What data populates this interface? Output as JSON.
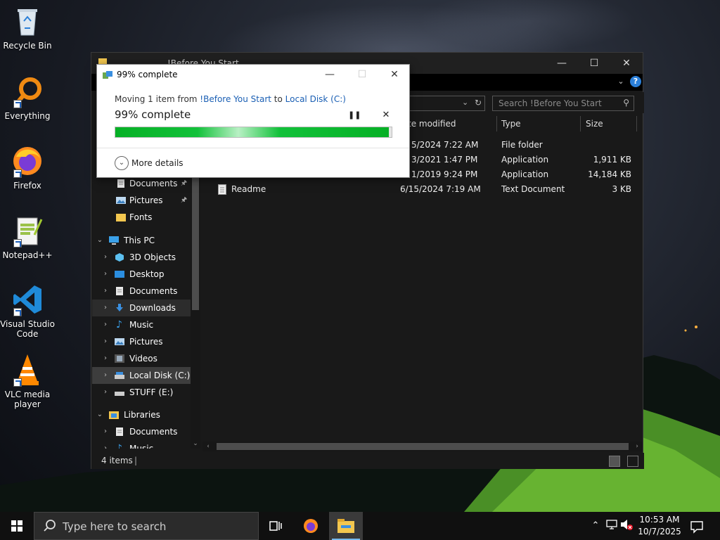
{
  "desktop": {
    "icons": [
      {
        "label": "Recycle Bin",
        "icon": "recycle-bin-icon"
      },
      {
        "label": "Everything",
        "icon": "everything-search-icon"
      },
      {
        "label": "Firefox",
        "icon": "firefox-icon"
      },
      {
        "label": "Notepad++",
        "icon": "notepad-plus-plus-icon"
      },
      {
        "label": "Visual Studio Code",
        "icon": "vscode-icon"
      },
      {
        "label": "VLC media player",
        "icon": "vlc-icon"
      }
    ]
  },
  "explorer": {
    "title": "!Before You Start",
    "search_placeholder": "Search !Before You Start",
    "columns": {
      "date": "Date modified",
      "type": "Type",
      "size": "Size"
    },
    "files": [
      {
        "name": "",
        "date": "6/15/2024 7:22 AM",
        "type": "File folder",
        "size": ""
      },
      {
        "name": "",
        "date": "6/3/2021 1:47 PM",
        "type": "Application",
        "size": "1,911 KB"
      },
      {
        "name": "",
        "date": "9/1/2019 9:24 PM",
        "type": "Application",
        "size": "14,184 KB"
      },
      {
        "name": "Readme",
        "date": "6/15/2024 7:19 AM",
        "type": "Text Document",
        "size": "3 KB"
      }
    ],
    "visible_dates": [
      "5/2024 7:22 AM",
      "3/2021 1:47 PM",
      "1/2019 9:24 PM",
      "6/15/2024 7:19 AM"
    ],
    "date_header_visible": "te modified",
    "nav": {
      "quick_access": [
        {
          "label": "Documents",
          "pinned": true
        },
        {
          "label": "Pictures",
          "pinned": true
        },
        {
          "label": "Fonts",
          "pinned": false
        }
      ],
      "this_pc": "This PC",
      "this_pc_items": [
        "3D Objects",
        "Desktop",
        "Documents",
        "Downloads",
        "Music",
        "Pictures",
        "Videos",
        "Local Disk (C:)",
        "STUFF (E:)"
      ],
      "libraries": "Libraries",
      "library_items": [
        "Documents",
        "Music"
      ]
    },
    "status": "4 items"
  },
  "dialog": {
    "title": "99% complete",
    "move_prefix": "Moving 1 item from ",
    "source": "!Before You Start",
    "to_word": " to ",
    "destination": "Local Disk (C:)",
    "heading": "99% complete",
    "progress": 0.99,
    "more_details": "More details"
  },
  "taskbar": {
    "search_placeholder": "Type here to search",
    "time": "10:53 AM",
    "date": "10/7/2025"
  },
  "colors": {
    "progress_green": "#06b025",
    "link_blue": "#1a5fb4",
    "accent": "#2b7fd8"
  }
}
